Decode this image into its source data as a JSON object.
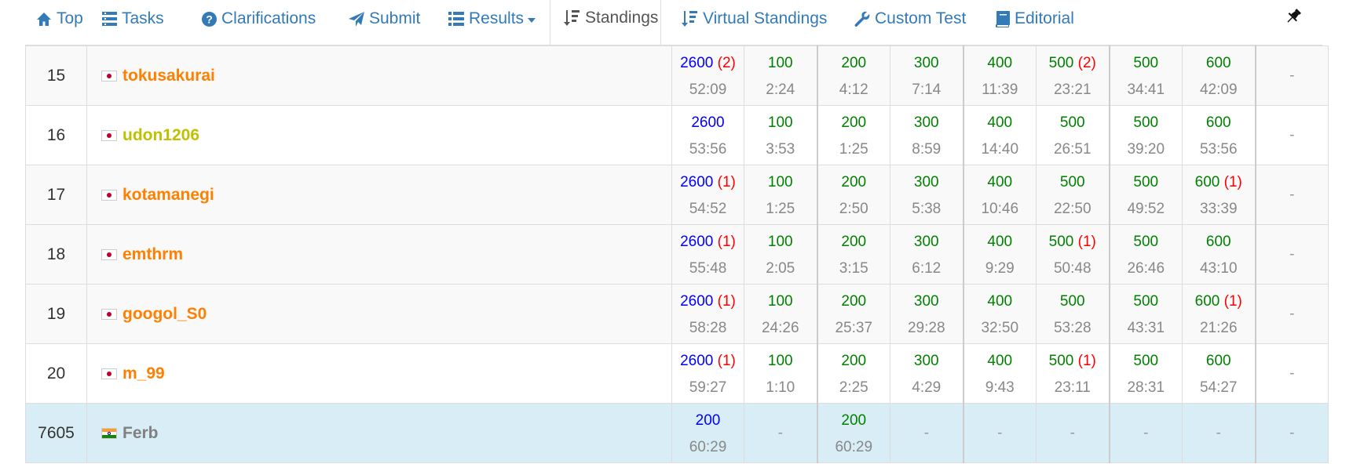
{
  "nav": {
    "top": "Top",
    "tasks": "Tasks",
    "clarifications": "Clarifications",
    "submit": "Submit",
    "results": "Results",
    "standings": "Standings",
    "virtual_standings": "Virtual Standings",
    "custom_test": "Custom Test",
    "editorial": "Editorial"
  },
  "colors": {
    "link": "#337ab7",
    "total": "#0000ff",
    "accepted": "#008000",
    "penalty": "#ff0000",
    "highlight_row": "#d9edf7"
  },
  "rows": [
    {
      "rank": "15",
      "user": "tokusakurai",
      "flag": "jp",
      "name_color": "orange",
      "style": "odd",
      "total": {
        "score": "2600",
        "penalty": "(2)",
        "time": "52:09"
      },
      "tasks": [
        {
          "score": "100",
          "penalty": "",
          "time": "2:24"
        },
        {
          "score": "200",
          "penalty": "",
          "time": "4:12"
        },
        {
          "score": "300",
          "penalty": "",
          "time": "7:14"
        },
        {
          "score": "400",
          "penalty": "",
          "time": "11:39"
        },
        {
          "score": "500",
          "penalty": "(2)",
          "time": "23:21"
        },
        {
          "score": "500",
          "penalty": "",
          "time": "34:41"
        },
        {
          "score": "600",
          "penalty": "",
          "time": "42:09"
        },
        {
          "score": "-",
          "penalty": "",
          "time": ""
        }
      ]
    },
    {
      "rank": "16",
      "user": "udon1206",
      "flag": "jp",
      "name_color": "yellow",
      "style": "even",
      "total": {
        "score": "2600",
        "penalty": "",
        "time": "53:56"
      },
      "tasks": [
        {
          "score": "100",
          "penalty": "",
          "time": "3:53"
        },
        {
          "score": "200",
          "penalty": "",
          "time": "1:25"
        },
        {
          "score": "300",
          "penalty": "",
          "time": "8:59"
        },
        {
          "score": "400",
          "penalty": "",
          "time": "14:40"
        },
        {
          "score": "500",
          "penalty": "",
          "time": "26:51"
        },
        {
          "score": "500",
          "penalty": "",
          "time": "39:20"
        },
        {
          "score": "600",
          "penalty": "",
          "time": "53:56"
        },
        {
          "score": "-",
          "penalty": "",
          "time": ""
        }
      ]
    },
    {
      "rank": "17",
      "user": "kotamanegi",
      "flag": "jp",
      "name_color": "orange",
      "style": "odd",
      "total": {
        "score": "2600",
        "penalty": "(1)",
        "time": "54:52"
      },
      "tasks": [
        {
          "score": "100",
          "penalty": "",
          "time": "1:25"
        },
        {
          "score": "200",
          "penalty": "",
          "time": "2:50"
        },
        {
          "score": "300",
          "penalty": "",
          "time": "5:38"
        },
        {
          "score": "400",
          "penalty": "",
          "time": "10:46"
        },
        {
          "score": "500",
          "penalty": "",
          "time": "22:50"
        },
        {
          "score": "500",
          "penalty": "",
          "time": "49:52"
        },
        {
          "score": "600",
          "penalty": "(1)",
          "time": "33:39"
        },
        {
          "score": "-",
          "penalty": "",
          "time": ""
        }
      ]
    },
    {
      "rank": "18",
      "user": "emthrm",
      "flag": "jp",
      "name_color": "orange",
      "style": "odd",
      "total": {
        "score": "2600",
        "penalty": "(1)",
        "time": "55:48"
      },
      "tasks": [
        {
          "score": "100",
          "penalty": "",
          "time": "2:05"
        },
        {
          "score": "200",
          "penalty": "",
          "time": "3:15"
        },
        {
          "score": "300",
          "penalty": "",
          "time": "6:12"
        },
        {
          "score": "400",
          "penalty": "",
          "time": "9:29"
        },
        {
          "score": "500",
          "penalty": "(1)",
          "time": "50:48"
        },
        {
          "score": "500",
          "penalty": "",
          "time": "26:46"
        },
        {
          "score": "600",
          "penalty": "",
          "time": "43:10"
        },
        {
          "score": "-",
          "penalty": "",
          "time": ""
        }
      ]
    },
    {
      "rank": "19",
      "user": "googol_S0",
      "flag": "jp",
      "name_color": "orange",
      "style": "odd",
      "total": {
        "score": "2600",
        "penalty": "(1)",
        "time": "58:28"
      },
      "tasks": [
        {
          "score": "100",
          "penalty": "",
          "time": "24:26"
        },
        {
          "score": "200",
          "penalty": "",
          "time": "25:37"
        },
        {
          "score": "300",
          "penalty": "",
          "time": "29:28"
        },
        {
          "score": "400",
          "penalty": "",
          "time": "32:50"
        },
        {
          "score": "500",
          "penalty": "",
          "time": "53:28"
        },
        {
          "score": "500",
          "penalty": "",
          "time": "43:31"
        },
        {
          "score": "600",
          "penalty": "(1)",
          "time": "21:26"
        },
        {
          "score": "-",
          "penalty": "",
          "time": ""
        }
      ]
    },
    {
      "rank": "20",
      "user": "m_99",
      "flag": "jp",
      "name_color": "orange",
      "style": "even",
      "total": {
        "score": "2600",
        "penalty": "(1)",
        "time": "59:27"
      },
      "tasks": [
        {
          "score": "100",
          "penalty": "",
          "time": "1:10"
        },
        {
          "score": "200",
          "penalty": "",
          "time": "2:25"
        },
        {
          "score": "300",
          "penalty": "",
          "time": "4:29"
        },
        {
          "score": "400",
          "penalty": "",
          "time": "9:43"
        },
        {
          "score": "500",
          "penalty": "(1)",
          "time": "23:11"
        },
        {
          "score": "500",
          "penalty": "",
          "time": "28:31"
        },
        {
          "score": "600",
          "penalty": "",
          "time": "54:27"
        },
        {
          "score": "-",
          "penalty": "",
          "time": ""
        }
      ]
    },
    {
      "rank": "7605",
      "user": "Ferb",
      "flag": "in",
      "name_color": "gray",
      "style": "self",
      "total": {
        "score": "200",
        "penalty": "",
        "time": "60:29"
      },
      "tasks": [
        {
          "score": "-",
          "penalty": "",
          "time": ""
        },
        {
          "score": "200",
          "penalty": "",
          "time": "60:29"
        },
        {
          "score": "-",
          "penalty": "",
          "time": ""
        },
        {
          "score": "-",
          "penalty": "",
          "time": ""
        },
        {
          "score": "-",
          "penalty": "",
          "time": ""
        },
        {
          "score": "-",
          "penalty": "",
          "time": ""
        },
        {
          "score": "-",
          "penalty": "",
          "time": ""
        },
        {
          "score": "-",
          "penalty": "",
          "time": ""
        }
      ]
    }
  ]
}
